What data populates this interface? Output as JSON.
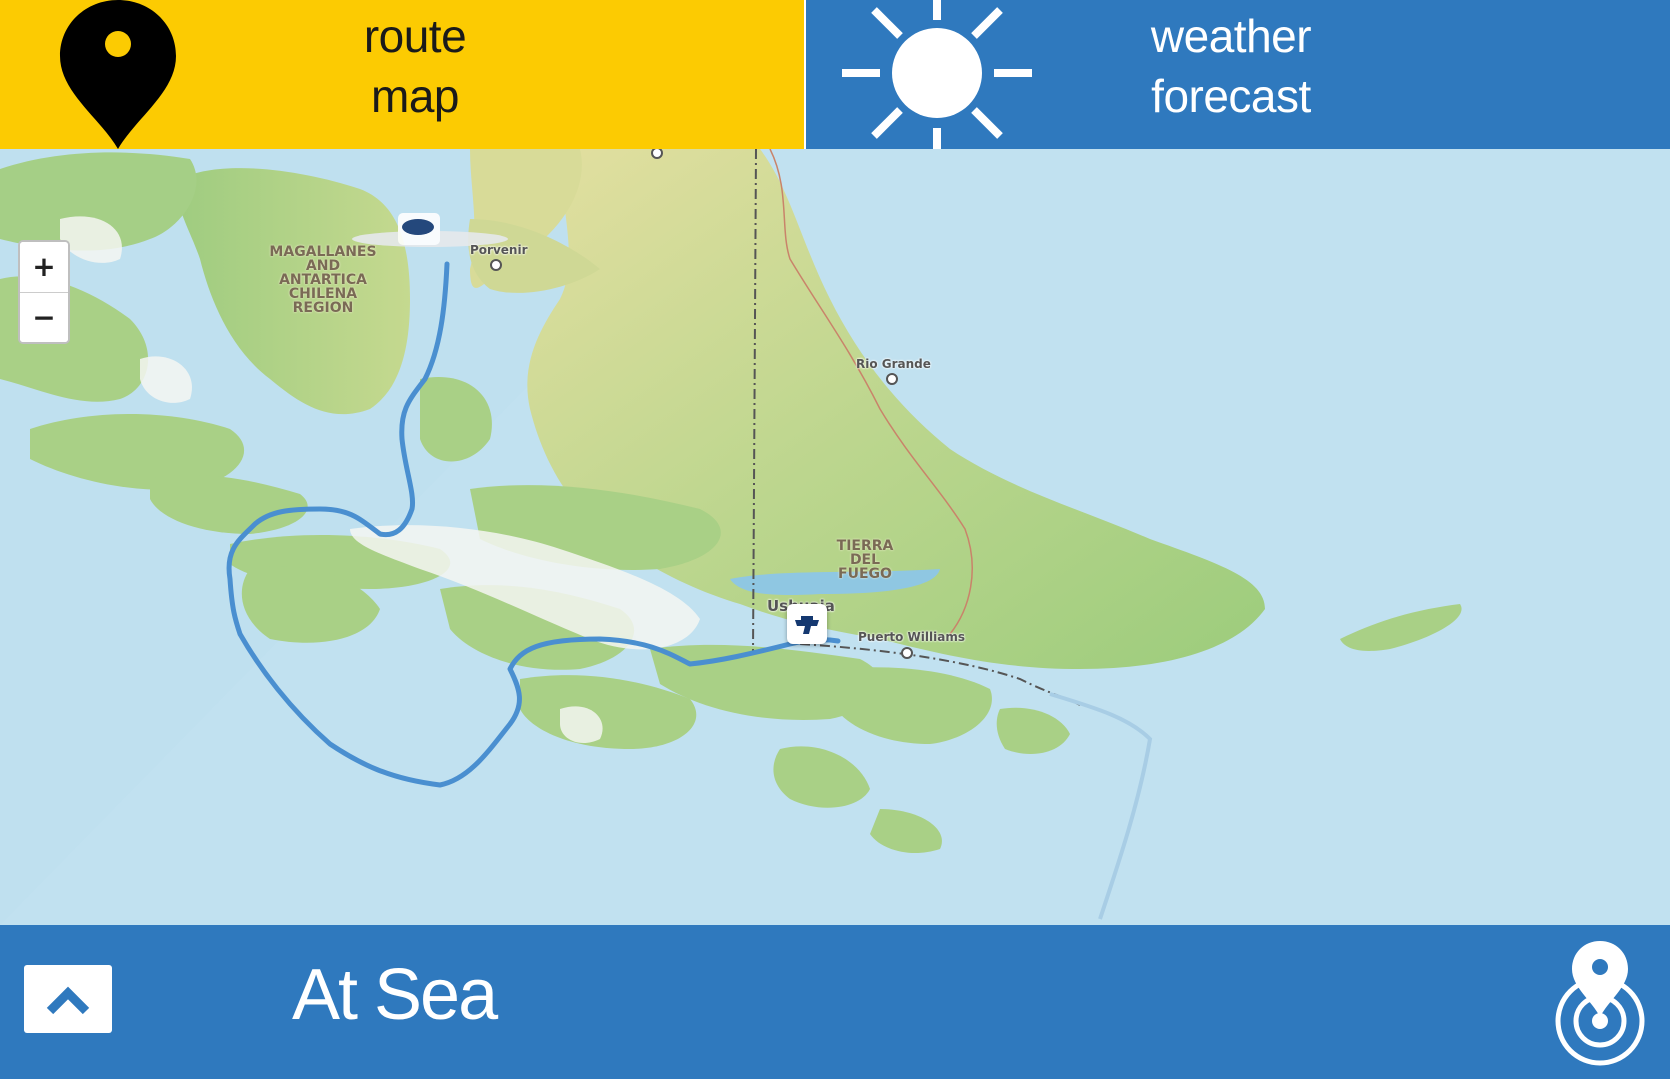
{
  "tabs": {
    "route": {
      "line1": "route",
      "line2": "map",
      "icon": "map-pin-icon",
      "color": "#fccb02"
    },
    "weather": {
      "line1": "weather",
      "line2": "forecast",
      "icon": "sun-icon",
      "color": "#2f79be"
    }
  },
  "map": {
    "zoom_in_label": "+",
    "zoom_out_label": "−",
    "region_labels": [
      {
        "lines": [
          "MAGALLANES",
          "AND",
          "ANTARTICA",
          "CHILENA",
          "REGION"
        ]
      },
      {
        "lines": [
          "TIERRA",
          "DEL",
          "FUEGO"
        ]
      }
    ],
    "towns": [
      "Porvenir",
      "Rio Grande",
      "Ushuaia",
      "Puerto Williams"
    ],
    "route_color": "#4a8fd0"
  },
  "bottom_bar": {
    "status": "At Sea",
    "expand_icon": "chevron-up-icon",
    "locate_icon": "locate-pin-icon"
  }
}
